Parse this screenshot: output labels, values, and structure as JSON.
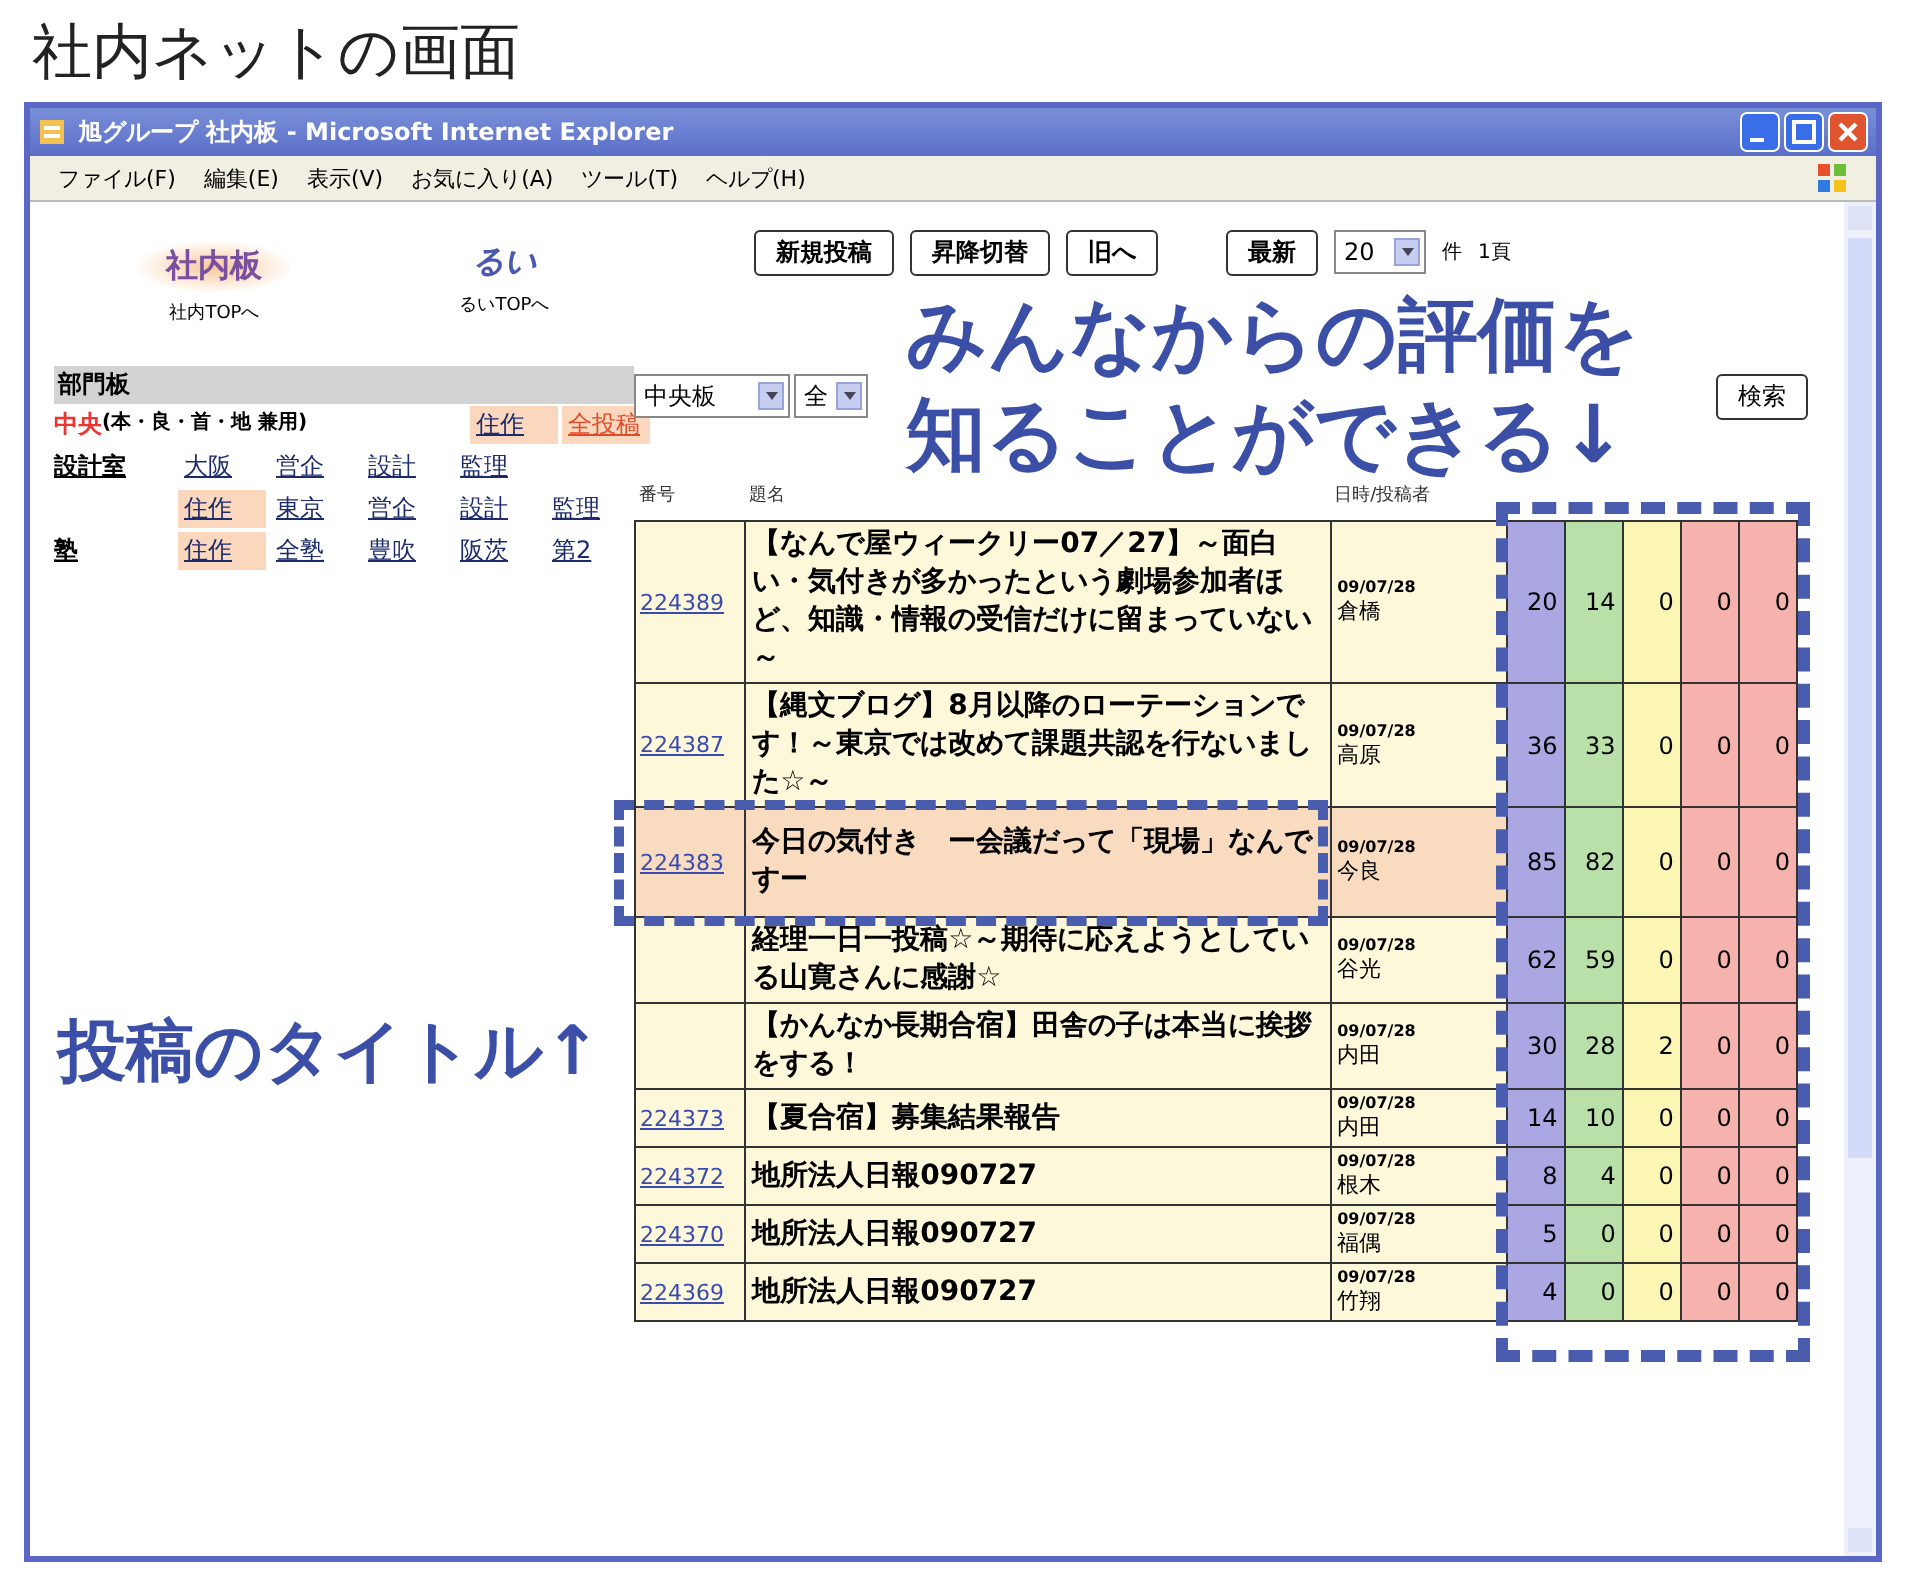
{
  "page_heading": "社内ネットの画面",
  "window": {
    "title": "旭グループ 社内板 - Microsoft Internet Explorer"
  },
  "menu": [
    "ファイル(F)",
    "編集(E)",
    "表示(V)",
    "お気に入り(A)",
    "ツール(T)",
    "ヘルプ(H)"
  ],
  "sidebar": {
    "logos": [
      {
        "name": "社内板",
        "link": "社内TOPへ"
      },
      {
        "name": "るい",
        "link": "るいTOPへ"
      }
    ],
    "section_title": "部門板",
    "rows": [
      {
        "label": "中央",
        "note": "(本・良・首・地 兼用)",
        "links": [
          {
            "text": "住作",
            "highlighted": true,
            "alert": false
          },
          {
            "text": "全投稿",
            "highlighted": true,
            "alert": true
          }
        ]
      },
      {
        "label": "設計室",
        "note": "",
        "links": [
          {
            "text": "大阪",
            "highlighted": false,
            "alert": false
          },
          {
            "text": "営企",
            "highlighted": false,
            "alert": false
          },
          {
            "text": "設計",
            "highlighted": false,
            "alert": false
          },
          {
            "text": "監理",
            "highlighted": false,
            "alert": false
          }
        ]
      },
      {
        "label": "",
        "note": "",
        "links": [
          {
            "text": "住作",
            "highlighted": true,
            "alert": false
          },
          {
            "text": "東京",
            "highlighted": false,
            "alert": false
          },
          {
            "text": "営企",
            "highlighted": false,
            "alert": false
          },
          {
            "text": "設計",
            "highlighted": false,
            "alert": false
          },
          {
            "text": "監理",
            "highlighted": false,
            "alert": false
          }
        ]
      },
      {
        "label": "塾",
        "note": "",
        "links": [
          {
            "text": "住作",
            "highlighted": true,
            "alert": false
          },
          {
            "text": "全塾",
            "highlighted": false,
            "alert": false
          },
          {
            "text": "豊吹",
            "highlighted": false,
            "alert": false
          },
          {
            "text": "阪茨",
            "highlighted": false,
            "alert": false
          },
          {
            "text": "第2",
            "highlighted": false,
            "alert": false
          }
        ]
      }
    ]
  },
  "toolbar": {
    "buttons": [
      "新規投稿",
      "昇降切替",
      "旧へ"
    ],
    "latest_button": "最新",
    "per_page": "20",
    "per_page_unit": "件",
    "page": "1頁"
  },
  "filter": {
    "board": "中央板",
    "scope": "全",
    "search_button": "検索"
  },
  "table": {
    "columns": [
      "番号",
      "題名",
      "日時/投稿者"
    ],
    "rating_columns": [
      {
        "color": "#aaa7e2"
      },
      {
        "color": "#b9e0a8"
      },
      {
        "color": "#fbf6b4"
      },
      {
        "color": "#f6b3ae"
      },
      {
        "color": "#f6b3ae"
      }
    ],
    "rows": [
      {
        "number": "224389",
        "title": "【なんで屋ウィークリー07／27】～面白い・気付きが多かったという劇場参加者ほど、知識・情報の受信だけに留まっていない～",
        "date": "09/07/28",
        "author": "倉橋",
        "highlighted": false,
        "ratings": [
          "20",
          "14",
          "0",
          "0",
          "0"
        ]
      },
      {
        "number": "224387",
        "title": "【縄文ブログ】8月以降のローテーションです！～東京では改めて課題共認を行ないました☆～",
        "date": "09/07/28",
        "author": "高原",
        "highlighted": false,
        "ratings": [
          "36",
          "33",
          "0",
          "0",
          "0"
        ]
      },
      {
        "number": "224383",
        "title": "今日の気付き　ー会議だって「現場」なんですー",
        "date": "09/07/28",
        "author": "今良",
        "highlighted": true,
        "ratings": [
          "85",
          "82",
          "0",
          "0",
          "0"
        ]
      },
      {
        "title": "経理一日一投稿☆～期待に応えようとしている山寛さんに感謝☆",
        "date": "09/07/28",
        "author": "谷光",
        "highlighted": false,
        "ratings": [
          "62",
          "59",
          "0",
          "0",
          "0"
        ]
      },
      {
        "title": "【かんなか長期合宿】田舎の子は本当に挨拶をする！",
        "date": "09/07/28",
        "author": "内田",
        "highlighted": false,
        "ratings": [
          "30",
          "28",
          "2",
          "0",
          "0"
        ]
      },
      {
        "number": "224373",
        "title": "【夏合宿】募集結果報告",
        "date": "09/07/28",
        "author": "内田",
        "highlighted": false,
        "ratings": [
          "14",
          "10",
          "0",
          "0",
          "0"
        ]
      },
      {
        "number": "224372",
        "title": "地所法人日報090727",
        "date": "09/07/28",
        "author": "根木",
        "highlighted": false,
        "ratings": [
          "8",
          "4",
          "0",
          "0",
          "0"
        ]
      },
      {
        "number": "224370",
        "title": "地所法人日報090727",
        "date": "09/07/28",
        "author": "福偶",
        "highlighted": false,
        "ratings": [
          "5",
          "0",
          "0",
          "0",
          "0"
        ]
      },
      {
        "number": "224369",
        "title": "地所法人日報090727",
        "date": "09/07/28",
        "author": "竹翔",
        "highlighted": false,
        "ratings": [
          "4",
          "0",
          "0",
          "0",
          "0"
        ]
      }
    ]
  },
  "annotations": [
    {
      "kind": "ratings",
      "lines": [
        "みんなからの評価を",
        "知ることができる↓"
      ]
    },
    {
      "kind": "title",
      "lines": [
        "投稿のタイトル↑"
      ]
    }
  ]
}
